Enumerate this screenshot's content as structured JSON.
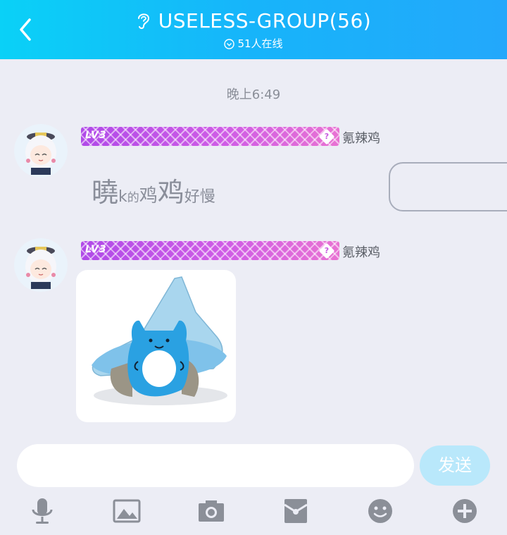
{
  "header": {
    "title": "USELESS-GROUP(56)",
    "online": "51人在线"
  },
  "chat": {
    "timestamp": "晚上6:49",
    "messages": [
      {
        "sender": "氪辣鸡",
        "level": "LV3",
        "level_help": "?",
        "text_parts": [
          "曉",
          "k",
          "的",
          "鸡",
          "鸡",
          "好慢"
        ]
      },
      {
        "sender": "氪辣鸡",
        "level": "LV3",
        "level_help": "?",
        "type": "sticker"
      }
    ]
  },
  "composer": {
    "placeholder": "",
    "send_label": "发送"
  },
  "toolbar": {
    "items": [
      "microphone-icon",
      "image-icon",
      "camera-icon",
      "red-packet-icon",
      "emoji-icon",
      "plus-icon"
    ]
  },
  "colors": {
    "header_start": "#0ad1f7",
    "header_end": "#23a8fb",
    "background": "#ecedf5",
    "send_button": "#b9e8fb",
    "toolbar_icon": "#8b8f98"
  }
}
